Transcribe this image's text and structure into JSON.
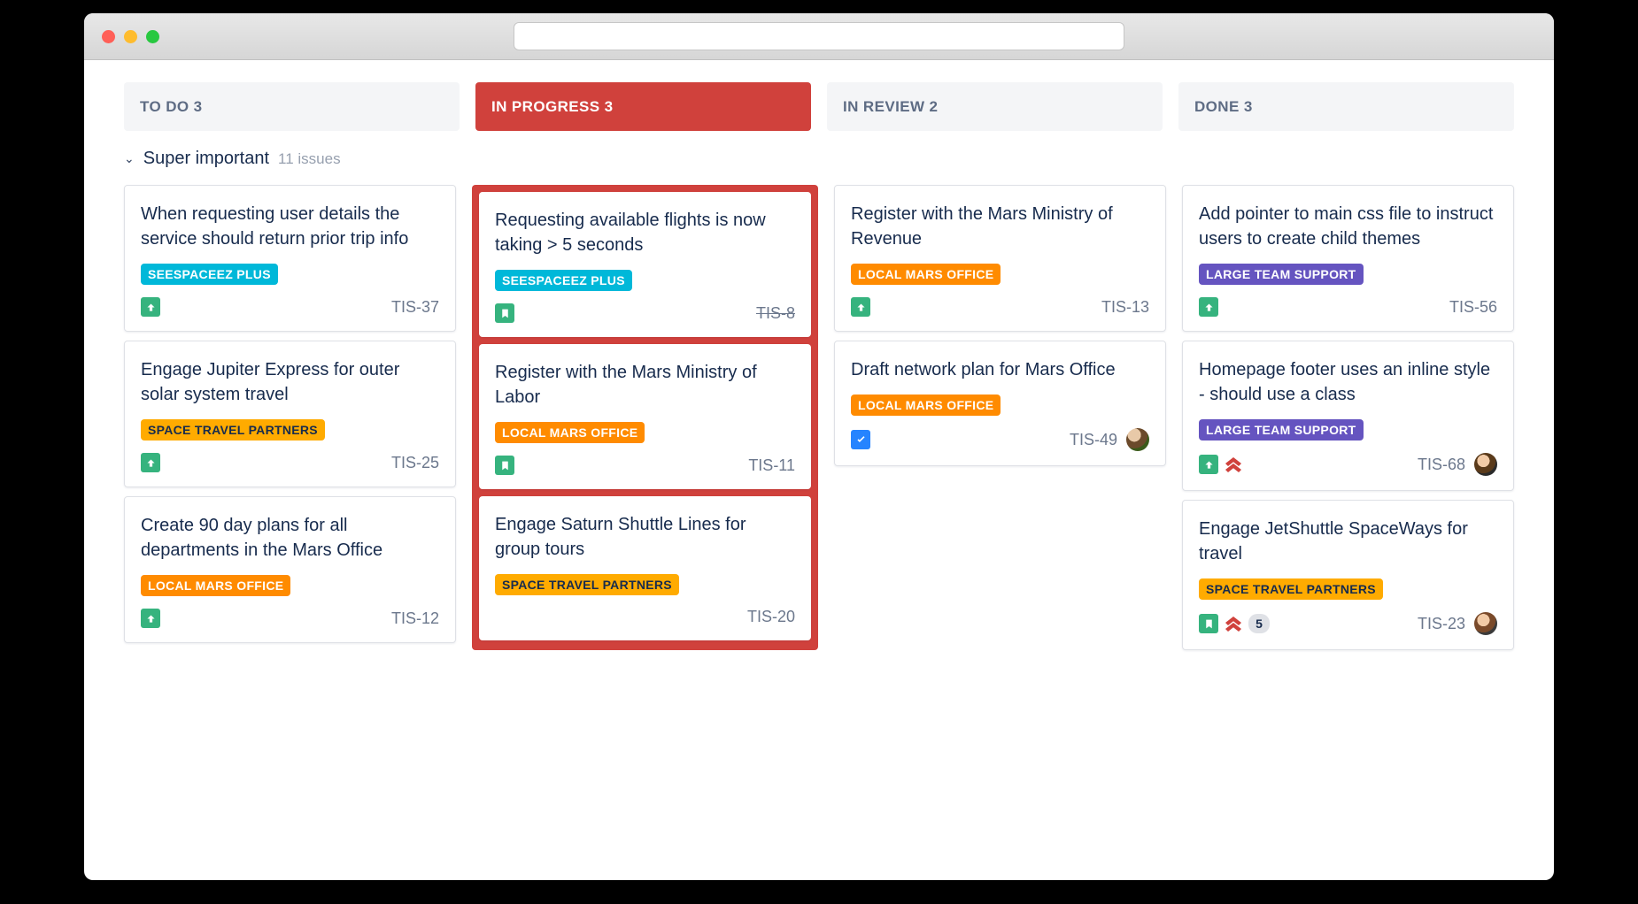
{
  "columns": [
    {
      "label": "TO DO 3",
      "active": false
    },
    {
      "label": "IN PROGRESS  3",
      "active": true
    },
    {
      "label": "IN REVIEW 2",
      "active": false
    },
    {
      "label": "DONE 3",
      "active": false
    }
  ],
  "swimlane": {
    "name": "Super important",
    "count": "11 issues"
  },
  "labels": {
    "seespaceez": "SEESPACEEZ PLUS",
    "space_travel": "SPACE TRAVEL PARTNERS",
    "local_mars": "LOCAL MARS OFFICE",
    "large_team": "LARGE TEAM SUPPORT"
  },
  "cards": {
    "todo": [
      {
        "title": "When requesting user details the service should return prior trip info",
        "label": "seespaceez",
        "type": "story",
        "key": "TIS-37"
      },
      {
        "title": "Engage Jupiter Express for outer solar system travel",
        "label": "space_travel",
        "type": "story",
        "key": "TIS-25"
      },
      {
        "title": "Create 90 day plans for all departments in the Mars Office",
        "label": "local_mars",
        "type": "story",
        "key": "TIS-12"
      }
    ],
    "inprogress": [
      {
        "title": "Requesting available flights is now taking > 5 seconds",
        "label": "seespaceez",
        "type": "bookmark",
        "key": "TIS-8",
        "strike": true
      },
      {
        "title": "Register with the Mars Ministry of Labor",
        "label": "local_mars",
        "type": "bookmark",
        "key": "TIS-11"
      },
      {
        "title": "Engage Saturn Shuttle Lines for group tours",
        "label": "space_travel",
        "key": "TIS-20",
        "no_icon": true
      }
    ],
    "inreview": [
      {
        "title": "Register with the Mars Ministry of Revenue",
        "label": "local_mars",
        "type": "story",
        "key": "TIS-13"
      },
      {
        "title": "Draft network plan for Mars Office",
        "label": "local_mars",
        "type": "task",
        "key": "TIS-49",
        "avatar": "a1"
      }
    ],
    "done": [
      {
        "title": "Add pointer to main css file to instruct users to create child themes",
        "label": "large_team",
        "type": "story",
        "key": "TIS-56"
      },
      {
        "title": "Homepage footer uses an inline style - should use a class",
        "label": "large_team",
        "type": "story",
        "key": "TIS-68",
        "priority": "highest",
        "avatar": "a2"
      },
      {
        "title": "Engage JetShuttle SpaceWays for travel",
        "label": "space_travel",
        "type": "bookmark",
        "key": "TIS-23",
        "priority": "highest",
        "badge": "5",
        "avatar": "a3"
      }
    ]
  }
}
